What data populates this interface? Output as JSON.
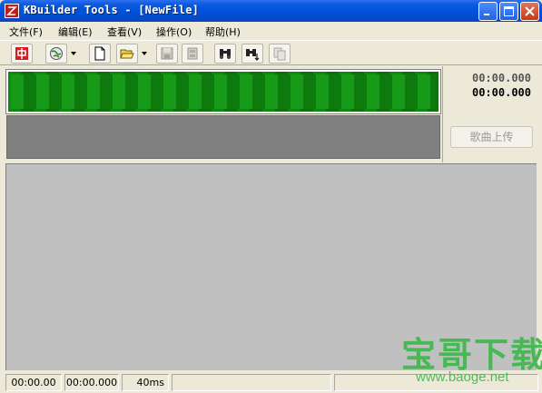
{
  "window": {
    "title": "KBuilder Tools - [NewFile]"
  },
  "menu": {
    "items": [
      "文件(F)",
      "编辑(E)",
      "查看(V)",
      "操作(O)",
      "帮助(H)"
    ]
  },
  "toolbar": {
    "buttons": [
      {
        "icon": "chinese-mode-icon",
        "enabled": true
      },
      {
        "icon": "globe-icon",
        "enabled": true,
        "dropdown": true
      },
      {
        "icon": "new-file-icon",
        "enabled": true
      },
      {
        "icon": "open-folder-icon",
        "enabled": true,
        "dropdown": true
      },
      {
        "icon": "save-icon",
        "enabled": false
      },
      {
        "icon": "save-as-icon",
        "enabled": false
      },
      {
        "icon": "find-icon",
        "enabled": true
      },
      {
        "icon": "find-next-icon",
        "enabled": true
      },
      {
        "icon": "copy-icon",
        "enabled": false
      }
    ]
  },
  "timing": {
    "time_top": "00:00.000",
    "time_bottom": "00:00.000"
  },
  "upload_button": {
    "label": "歌曲上传",
    "enabled": false
  },
  "statusbar": {
    "position": "00:00.00",
    "length": "00:00.000",
    "interval": "40ms"
  },
  "watermark": {
    "brand": "宝哥下载",
    "url": "www.baoge.net"
  },
  "colors": {
    "title_bar": "#0050d8",
    "waveform_green": "#179a17",
    "main_area": "#c0c0c0",
    "watermark": "#3cb84a"
  }
}
